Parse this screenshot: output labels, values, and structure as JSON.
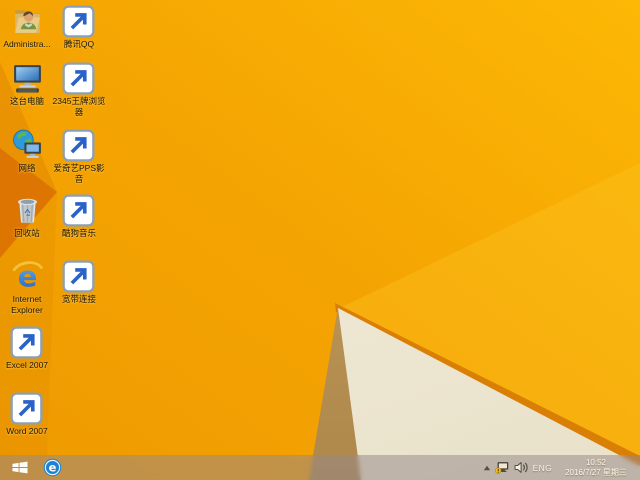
{
  "wallpaper": {
    "base_color_left": "#ee9a01",
    "base_color_right": "#fcb805",
    "dark_wedge_color": "#dd7503",
    "tan_facet_color": "#c9a766",
    "cream_facet_color": "#f1ecdb",
    "edge_shadow_color": "#d97f05"
  },
  "desktop": {
    "column1": [
      {
        "label": "Administra...",
        "icon": "user-folder-icon"
      },
      {
        "label": "这台电脑",
        "icon": "this-pc-icon"
      },
      {
        "label": "网络",
        "icon": "network-icon"
      },
      {
        "label": "回收站",
        "icon": "recycle-bin-icon"
      },
      {
        "label": "Internet Explorer",
        "icon": "internet-explorer-icon"
      },
      {
        "label": "Excel 2007",
        "icon": "excel-icon"
      },
      {
        "label": "Word 2007",
        "icon": "word-icon"
      }
    ],
    "column2": [
      {
        "label": "腾讯QQ",
        "icon": "qq-icon"
      },
      {
        "label": "2345王牌浏览器",
        "icon": "2345-browser-icon"
      },
      {
        "label": "爱奇艺PPS影音",
        "icon": "iqiyi-pps-icon"
      },
      {
        "label": "酷狗音乐",
        "icon": "kugou-music-icon"
      },
      {
        "label": "宽带连接",
        "icon": "broadband-connection-icon"
      }
    ]
  },
  "taskbar": {
    "start_button_icon": "windows-logo-icon",
    "pinned_icon": "internet-explorer-taskbar-icon",
    "tray": {
      "hidden_icons_icon": "chevron-up-icon",
      "network_icon": "network-warning-icon",
      "volume_icon": "speaker-icon",
      "language": "ENG",
      "time": "10:52",
      "date": "2016/7/27 星期三"
    }
  }
}
